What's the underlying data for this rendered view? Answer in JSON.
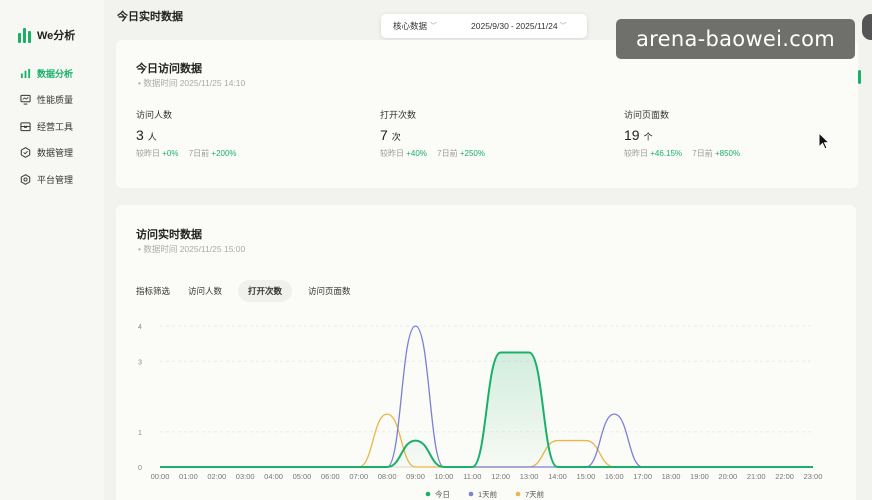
{
  "app": {
    "logo_text": "We分析"
  },
  "sidebar": {
    "items": [
      {
        "label": "数据分析",
        "icon": "bar-chart-icon",
        "active": true
      },
      {
        "label": "性能质量",
        "icon": "monitor-icon",
        "active": false
      },
      {
        "label": "经营工具",
        "icon": "toolbox-icon",
        "active": false
      },
      {
        "label": "数据管理",
        "icon": "hexagon-icon",
        "active": false
      },
      {
        "label": "平台管理",
        "icon": "settings-icon",
        "active": false
      }
    ]
  },
  "page_title": "今日实时数据",
  "filter": {
    "core_label": "核心数据",
    "date_start": "2025/9/30",
    "date_sep": "-",
    "date_end": "2025/11/24"
  },
  "watermark": "arena-baowei.com",
  "today_card": {
    "title": "今日访问数据",
    "subtitle": "数据时间 2025/11/25 14:10",
    "metrics": [
      {
        "label": "访问人数",
        "value": "3",
        "unit": "人",
        "cmp1_label": "较昨日",
        "cmp1_value": "+0%",
        "cmp2_label": "7日前",
        "cmp2_value": "+200%"
      },
      {
        "label": "打开次数",
        "value": "7",
        "unit": "次",
        "cmp1_label": "较昨日",
        "cmp1_value": "+40%",
        "cmp2_label": "7日前",
        "cmp2_value": "+250%"
      },
      {
        "label": "访问页面数",
        "value": "19",
        "unit": "个",
        "cmp1_label": "较昨日",
        "cmp1_value": "+46.15%",
        "cmp2_label": "7日前",
        "cmp2_value": "+850%"
      }
    ]
  },
  "realtime_card": {
    "title": "访问实时数据",
    "subtitle": "数据时间 2025/11/25 15:00",
    "filter_label": "指标筛选",
    "tabs": [
      {
        "label": "访问人数",
        "active": false
      },
      {
        "label": "打开次数",
        "active": true
      },
      {
        "label": "访问页面数",
        "active": false
      }
    ]
  },
  "colors": {
    "accent": "#1ab06a",
    "today": "#1ab06a",
    "yesterday": "#7b80d6",
    "week_ago": "#e8b64a"
  },
  "chart_data": {
    "type": "line",
    "smooth": true,
    "categories": [
      "00:00",
      "01:00",
      "02:00",
      "03:00",
      "04:00",
      "05:00",
      "06:00",
      "07:00",
      "08:00",
      "09:00",
      "10:00",
      "11:00",
      "12:00",
      "13:00",
      "14:00",
      "15:00",
      "16:00",
      "17:00",
      "18:00",
      "19:00",
      "20:00",
      "21:00",
      "22:00",
      "23:00"
    ],
    "ylim": [
      0,
      4
    ],
    "yticks": [
      "0",
      "1",
      "3",
      "4"
    ],
    "grid": true,
    "legend_position": "bottom-center",
    "series": [
      {
        "name": "今日",
        "color": "#1ab06a",
        "area": true,
        "values": [
          0,
          0,
          0,
          0,
          0,
          0,
          0,
          0,
          0,
          0.75,
          0,
          0,
          3.25,
          3.25,
          0,
          0,
          0,
          0,
          0,
          0,
          0,
          0,
          0,
          0
        ]
      },
      {
        "name": "1天前",
        "color": "#7b80d6",
        "area": false,
        "values": [
          0,
          0,
          0,
          0,
          0,
          0,
          0,
          0,
          0,
          4,
          0,
          0,
          0,
          0,
          0,
          0,
          1.5,
          0,
          0,
          0,
          0,
          0,
          0,
          0
        ]
      },
      {
        "name": "7天前",
        "color": "#e8b64a",
        "area": false,
        "values": [
          0,
          0,
          0,
          0,
          0,
          0,
          0,
          0,
          1.5,
          0,
          0,
          0,
          0,
          0,
          0.75,
          0.75,
          0,
          0,
          0,
          0,
          0,
          0,
          0,
          0
        ]
      }
    ]
  }
}
